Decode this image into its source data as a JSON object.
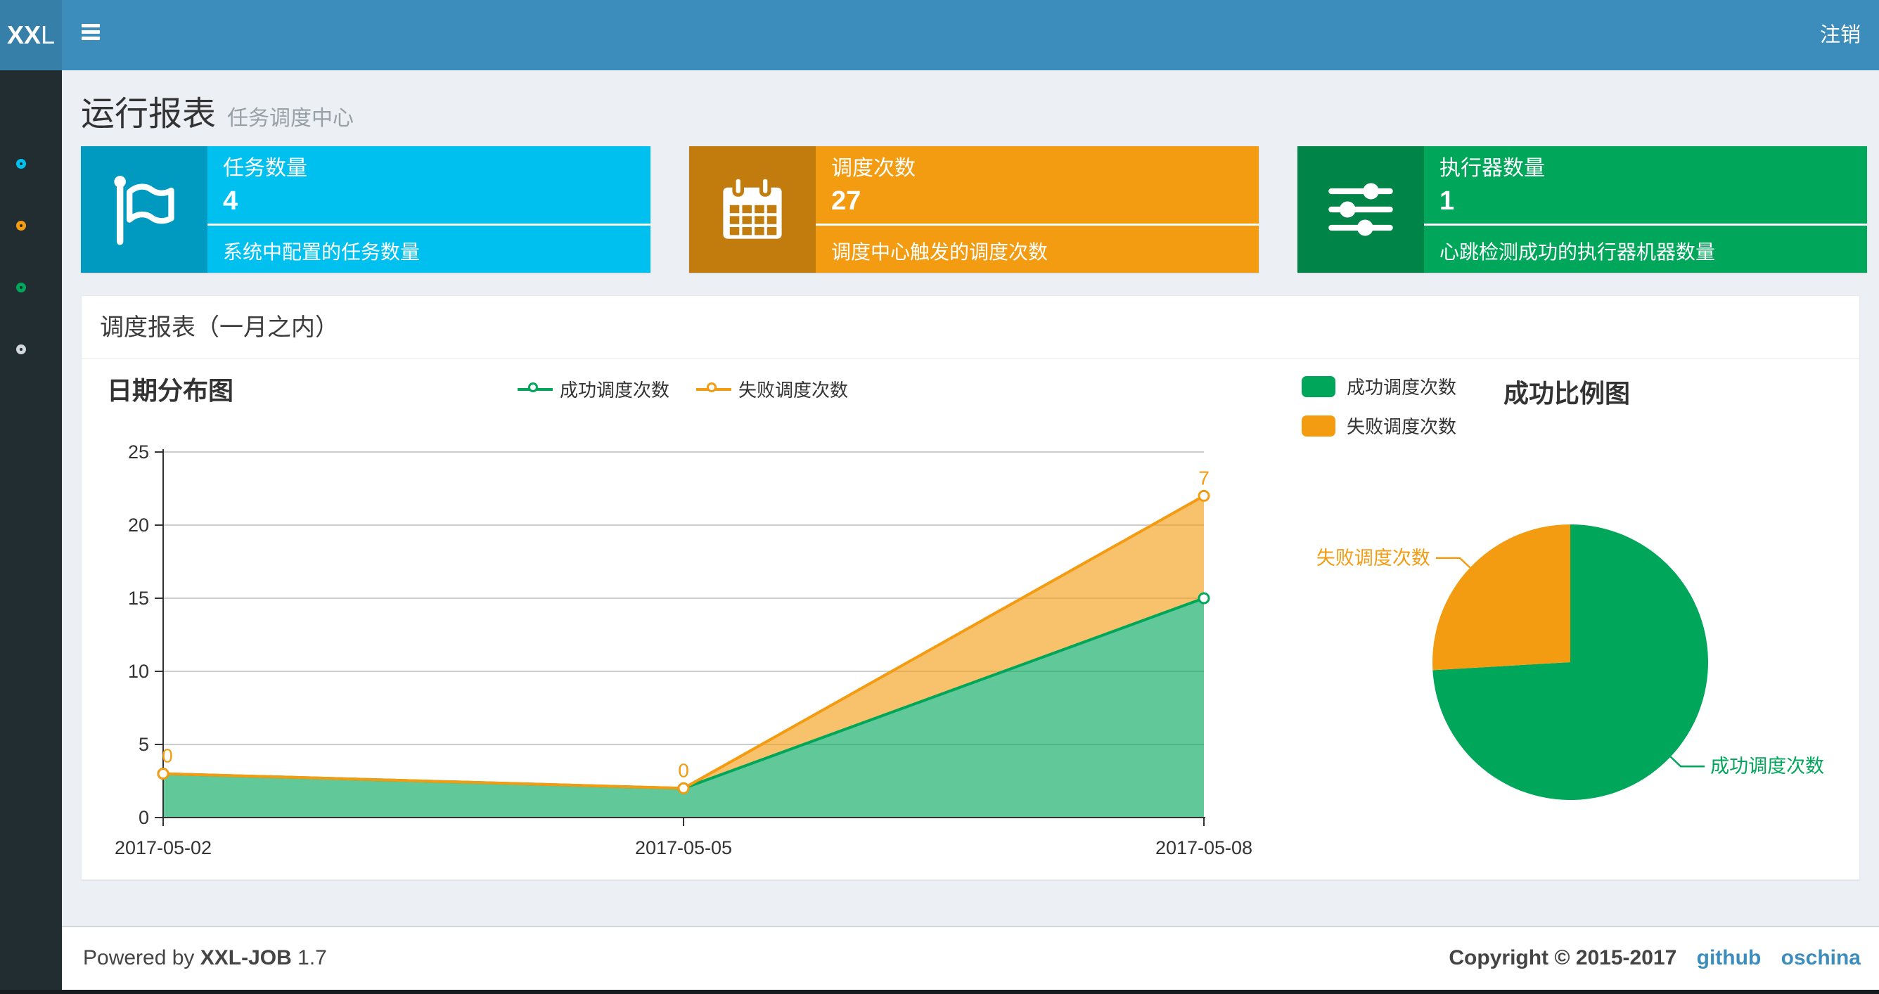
{
  "navbar": {
    "logo_bold": "XX",
    "logo_light": "L",
    "logout_label": "注销"
  },
  "sidebar": {
    "items": [
      {
        "name": "report",
        "color": "#00c0ef"
      },
      {
        "name": "job",
        "color": "#f39c12"
      },
      {
        "name": "log",
        "color": "#00a65a"
      },
      {
        "name": "help",
        "color": "#d2d6de"
      }
    ]
  },
  "page_header": {
    "title": "运行报表",
    "subtitle": "任务调度中心"
  },
  "info_boxes": [
    {
      "title": "任务数量",
      "value": "4",
      "desc": "系统中配置的任务数量",
      "bg": "#00c0ef",
      "icon": "flag-icon"
    },
    {
      "title": "调度次数",
      "value": "27",
      "desc": "调度中心触发的调度次数",
      "bg": "#f39c12",
      "icon": "calendar-icon"
    },
    {
      "title": "执行器数量",
      "value": "1",
      "desc": "心跳检测成功的执行器机器数量",
      "bg": "#00a65a",
      "icon": "sliders-icon"
    }
  ],
  "panel": {
    "title": "调度报表（一月之内）"
  },
  "chart_data": [
    {
      "type": "area",
      "title": "日期分布图",
      "x": [
        "2017-05-02",
        "2017-05-05",
        "2017-05-08"
      ],
      "series": [
        {
          "name": "成功调度次数",
          "values": [
            3,
            2,
            15
          ],
          "color": "#00a65a"
        },
        {
          "name": "失败调度次数",
          "values": [
            0,
            0,
            7
          ],
          "color": "#f39c12"
        }
      ],
      "stacked": true,
      "point_labels_series": "失败调度次数",
      "point_labels": [
        "0",
        "0",
        "7"
      ],
      "ylim": [
        0,
        25
      ],
      "yticks": [
        0,
        5,
        10,
        15,
        20,
        25
      ],
      "grid": true,
      "legend_position": "top-center"
    },
    {
      "type": "pie",
      "title": "成功比例图",
      "slices": [
        {
          "label": "成功调度次数",
          "value": 20,
          "color": "#00a65a"
        },
        {
          "label": "失败调度次数",
          "value": 7,
          "color": "#f39c12"
        }
      ],
      "start_angle": 90,
      "legend_position": "top-left"
    }
  ],
  "footer": {
    "powered_by": "Powered by",
    "product": "XXL-JOB",
    "version": "1.7",
    "copyright": "Copyright © 2015-2017",
    "links": [
      "github",
      "oschina"
    ]
  }
}
